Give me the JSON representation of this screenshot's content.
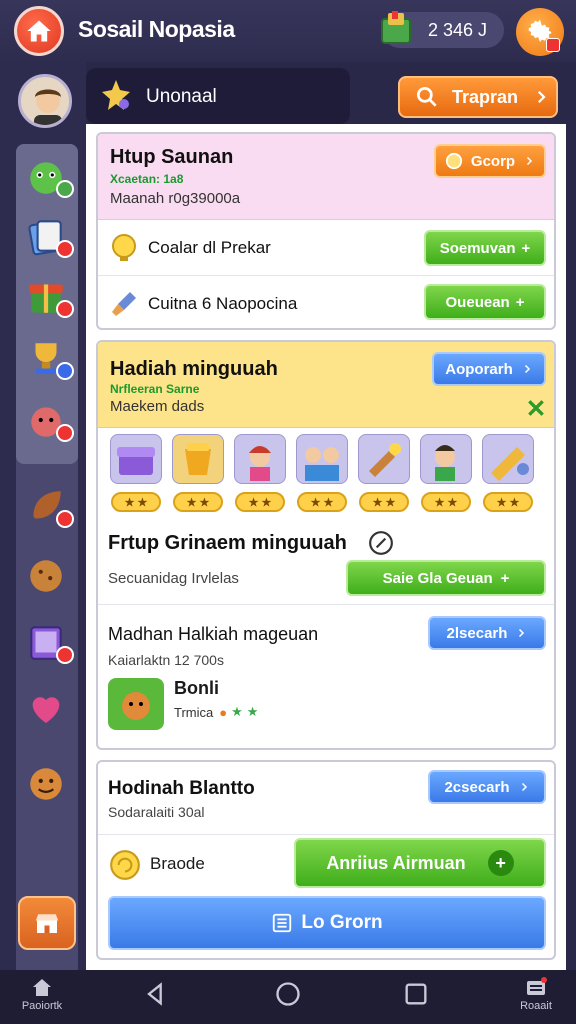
{
  "app": {
    "title": "Sosail Nopasia",
    "coins": "2 346 J"
  },
  "header": {
    "label": "Unonaal",
    "top_button": "Trapran"
  },
  "card1": {
    "title": "Htup Saunan",
    "green_text": "Xcaetan: 1a8",
    "subtitle": "Maanah r0g39000a",
    "button": "Gcorp",
    "rows": [
      {
        "label": "Coalar dl Prekar",
        "button": "Soemuvan"
      },
      {
        "label": "Cuitna 6 Naopocina",
        "button": "Oueuean"
      }
    ]
  },
  "card2": {
    "title": "Hadiah minguuah",
    "green_text": "Nrfleeran Sarne",
    "subtitle": "Maekem dads",
    "button": "Aoporarh",
    "rewards": [
      "",
      "",
      "",
      "",
      "",
      "",
      ""
    ],
    "section1": {
      "title": "Frtup Grinaem minguuah",
      "subtitle": "Secuanidag Irvlelas",
      "button": "Saie Gla Geuan"
    },
    "section2": {
      "title": "Madhan Halkiah mageuan",
      "subtitle": "Kaiarlaktn 12 700s",
      "button": "2lsecarh",
      "item_name": "Bonli",
      "item_sub": "Trmica"
    }
  },
  "card3": {
    "title": "Hodinah Blantto",
    "subtitle": "Sodaralaiti 30al",
    "button": "2csecarh",
    "row_label": "Braode",
    "green_button": "Anriius Airmuan",
    "blue_button": "Lo Grorn"
  },
  "nav": {
    "left_label": "Paoiortk",
    "right_label": "Roaait"
  },
  "colors": {
    "accent_orange": "#ee7a12",
    "accent_green": "#3fae1a",
    "accent_blue": "#3a7ae8",
    "bg": "#2a2848"
  }
}
